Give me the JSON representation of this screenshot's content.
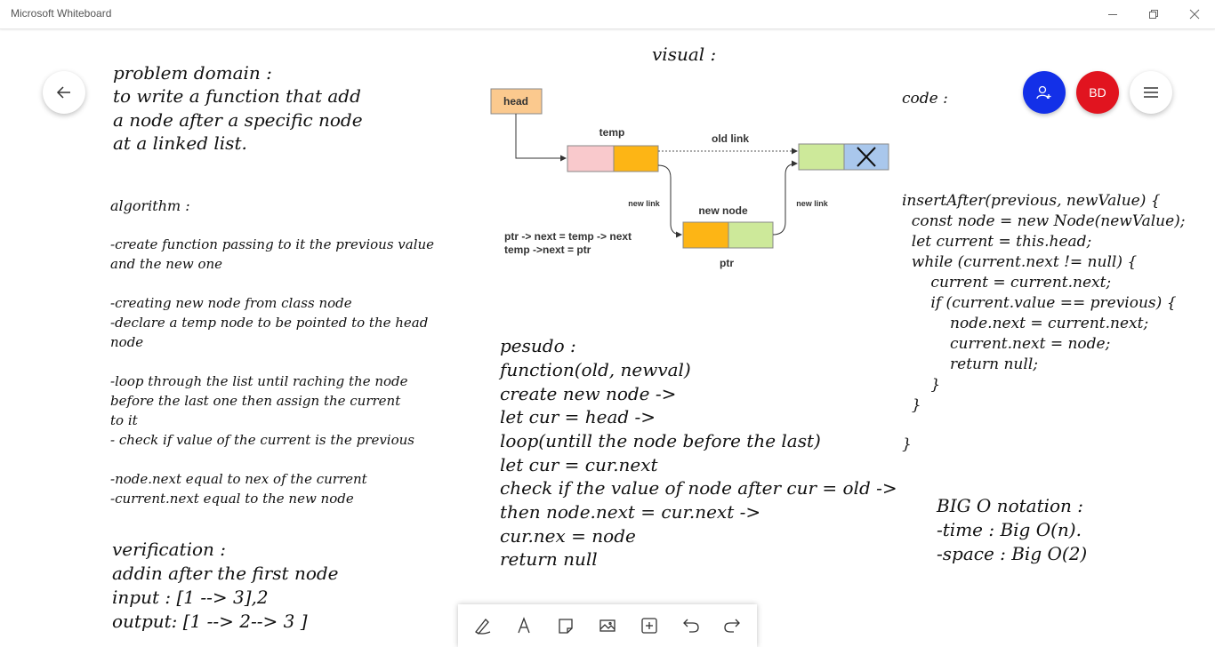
{
  "window": {
    "title": "Microsoft Whiteboard"
  },
  "topbar": {
    "avatar_initials": "BD",
    "invite_color": "#1330e8",
    "avatar_color": "#e1141f"
  },
  "canvas": {
    "problem": [
      "problem domain :",
      "to write a function that add",
      "a node after a specific node",
      "at a linked list."
    ],
    "algorithm_title": "algorithm :",
    "algorithm": [
      "-create function passing to it the previous value",
      "and the new one",
      "",
      "-creating new node from class node",
      "-declare a temp node to be pointed to the head",
      "node",
      "",
      "-loop through the list until raching the node",
      "before the last one then assign the current",
      "to it",
      "- check if value of the current is the previous",
      "",
      "-node.next equal to nex of the current",
      "-current.next equal to the new node"
    ],
    "verification": [
      "verification :",
      "addin after the first node",
      "input : [1 --> 3],2",
      "output: [1 --> 2--> 3 ]"
    ],
    "visual_title": "visual :",
    "pseudo": [
      "pesudo :",
      "function(old, newval)",
      "create new node ->",
      "let cur = head ->",
      "loop(untill the node before the last)",
      "let cur = cur.next",
      "check if the value of node after cur = old ->",
      "then node.next = cur.next ->",
      "cur.nex = node",
      "return null"
    ],
    "code_title": "code :",
    "code": [
      "insertAfter(previous, newValue) {",
      "  const node = new Node(newValue);",
      "  let current = this.head;",
      "  while (current.next != null) {",
      "      current = current.next;",
      "      if (current.value == previous) {",
      "          node.next = current.next;",
      "          current.next = node;",
      "          return null;",
      "      }",
      "  }",
      "",
      "}"
    ],
    "bigo": [
      "BIG O notation :",
      "-time : Big O(n).",
      "-space : Big O(2)"
    ]
  },
  "diagram": {
    "head": "head",
    "temp": "temp",
    "old_link": "old link",
    "new_link_left": "new link",
    "new_link_right": "new link",
    "new_node": "new node",
    "ptr": "ptr",
    "note_line1": "ptr -> next = temp -> next",
    "note_line2": "temp ->next = ptr",
    "colors": {
      "head": "#fbc98e",
      "pink": "#f9c9cc",
      "orange": "#fdb515",
      "green": "#cde99a",
      "blue": "#a9c7ec"
    }
  },
  "icons": [
    "back-arrow-icon",
    "add-person-icon",
    "hamburger-menu-icon",
    "pen-icon",
    "text-icon",
    "sticky-note-icon",
    "image-icon",
    "add-icon",
    "undo-icon",
    "redo-icon",
    "minimize-icon",
    "restore-icon",
    "close-icon"
  ]
}
